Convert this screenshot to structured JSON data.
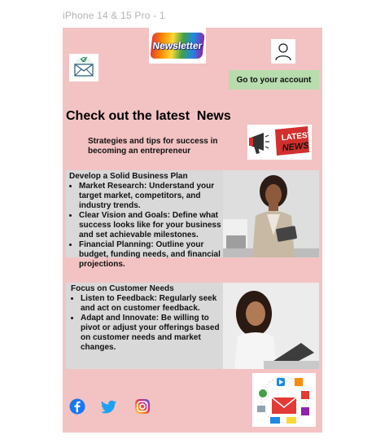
{
  "frame": {
    "label": "iPhone 14 & 15 Pro - 1"
  },
  "header": {
    "logo_text": "Newsletter",
    "account_button": "Go to your account"
  },
  "hero": {
    "headline": "Check out the latest  News",
    "subline": "Strategies and tips for success in becoming an entrepreneur",
    "badge_line1": "LATEST",
    "badge_line2": "NEWS"
  },
  "sections": [
    {
      "title": "Develop a Solid Business Plan",
      "bullets": [
        "Market Research: Understand your target market, competitors, and industry trends.",
        "Clear Vision and Goals: Define what success looks like for your business and set achievable milestones.",
        "Financial Planning: Outline your budget, funding needs, and financial projections."
      ]
    },
    {
      "title": "Focus on Customer Needs",
      "bullets": [
        "Listen to Feedback: Regularly seek and act on customer feedback.",
        "Adapt and Innovate: Be willing to pivot or adjust your offerings based on customer needs and market changes."
      ]
    }
  ],
  "footer": {
    "social_icons": [
      "facebook-icon",
      "twitter-icon",
      "instagram-icon"
    ]
  },
  "colors": {
    "background": "#f3c3c3",
    "section_bg": "#d9d9d9",
    "button_bg": "#b7dcae",
    "facebook": "#1877f2",
    "twitter": "#1da1f2"
  }
}
